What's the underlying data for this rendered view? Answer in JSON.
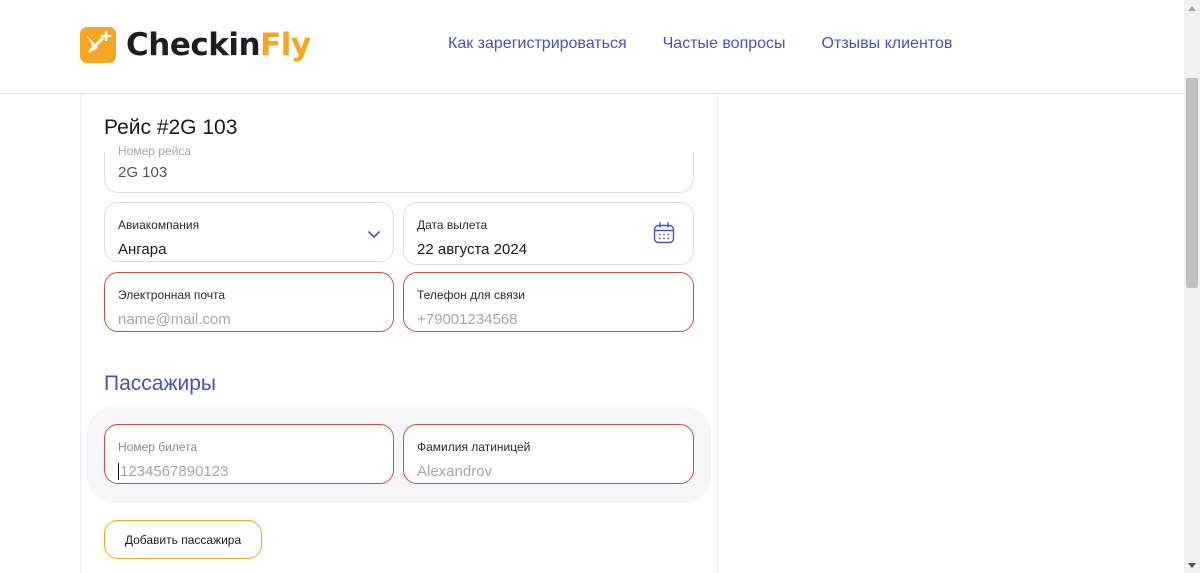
{
  "header": {
    "logo": {
      "text_main": "Checkin",
      "text_accent": "Fly",
      "icon": "checkinfly-logo-icon"
    },
    "nav": [
      {
        "label": "Как зарегистрироваться"
      },
      {
        "label": "Частые вопросы"
      },
      {
        "label": "Отзывы клиентов"
      }
    ]
  },
  "form": {
    "title": "Рейс #2G 103",
    "flight_number": {
      "label": "Номер рейса",
      "value": "2G 103"
    },
    "airline": {
      "label": "Авиакомпания",
      "value": "Ангара",
      "icon": "chevron-down-icon"
    },
    "departure_date": {
      "label": "Дата вылета",
      "value": "22 августа 2024",
      "icon": "calendar-icon"
    },
    "email": {
      "label": "Электронная почта",
      "placeholder": "name@mail.com"
    },
    "phone": {
      "label": "Телефон для связи",
      "placeholder": "+79001234568"
    }
  },
  "passengers": {
    "title": "Пассажиры",
    "ticket_number": {
      "label": "Номер билета",
      "placeholder": "1234567890123"
    },
    "last_name": {
      "label": "Фамилия латиницей",
      "placeholder": "Alexandrov"
    },
    "add_button": "Добавить пассажира"
  },
  "colors": {
    "accent": "#4a50c8",
    "brand_orange": "#f5a623",
    "error": "#e04848"
  }
}
